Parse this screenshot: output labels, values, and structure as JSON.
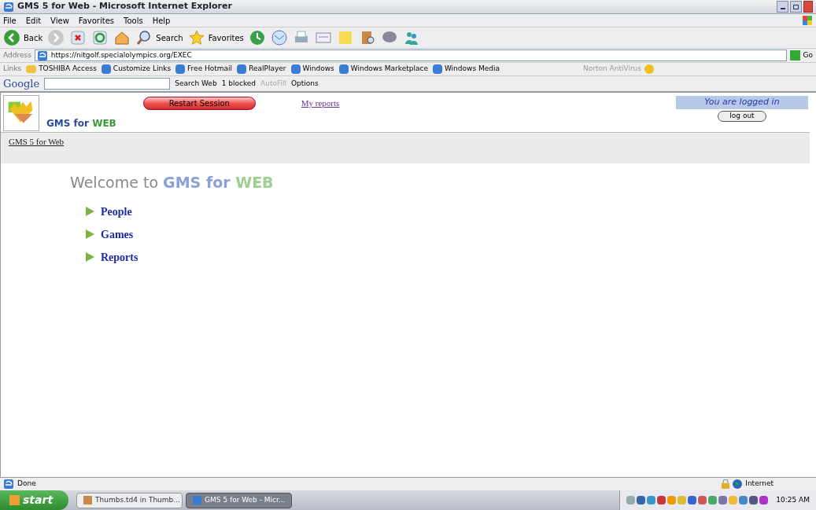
{
  "window": {
    "title": "GMS 5 for Web - Microsoft Internet Explorer"
  },
  "menu": [
    "File",
    "Edit",
    "View",
    "Favorites",
    "Tools",
    "Help"
  ],
  "toolbar": [
    {
      "kind": "back",
      "label": "Back"
    },
    {
      "kind": "forward"
    },
    {
      "kind": "stop"
    },
    {
      "kind": "refresh"
    },
    {
      "kind": "home"
    },
    {
      "kind": "search",
      "label": "Search"
    },
    {
      "kind": "favorites",
      "label": "Favorites"
    },
    {
      "kind": "history"
    },
    {
      "kind": "mail"
    },
    {
      "kind": "print"
    },
    {
      "kind": "edit"
    },
    {
      "kind": "note"
    },
    {
      "kind": "research"
    },
    {
      "kind": "chat"
    },
    {
      "kind": "messenger"
    }
  ],
  "address": {
    "label": "Address",
    "value": "https://nitgolf.specialolympics.org/EXEC",
    "go": "Go"
  },
  "links": {
    "label": "Links",
    "items": [
      "TOSHIBA Access",
      "Customize Links",
      "Free Hotmail",
      "RealPlayer",
      "Windows",
      "Windows Marketplace",
      "Windows Media"
    ],
    "norton": "Norton AntiVirus"
  },
  "google": {
    "logo": "Google",
    "search": "Search Web",
    "blocked": "1 blocked",
    "autofill": "AutoFill",
    "options": "Options"
  },
  "page": {
    "brand_a": "GMS for ",
    "brand_b": "WEB",
    "restart": "Restart Session",
    "my_reports": "My reports",
    "logged_in": "You are logged in",
    "logout": "log out",
    "breadcrumb": "GMS 5 for Web",
    "welcome_a": "Welcome to ",
    "welcome_b": "GMS for ",
    "welcome_c": "WEB",
    "nav": [
      "People",
      "Games",
      "Reports"
    ]
  },
  "status_bar": {
    "text": "Done",
    "zone": "Internet"
  },
  "taskbar": {
    "start": "start",
    "items": [
      {
        "label": "Thumbs.td4 in Thumb...",
        "selected": false
      },
      {
        "label": "GMS 5 for Web - Micr...",
        "selected": true
      }
    ],
    "clock": "10:25 AM"
  }
}
